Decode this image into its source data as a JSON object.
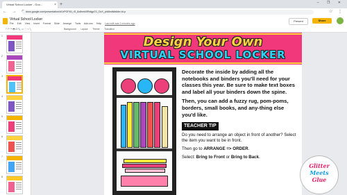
{
  "browser": {
    "tab_title": "Virtual School Locker - Goo...",
    "tab_close": "×",
    "new_tab": "+",
    "url": "docs.google.com/presentation/d/1rPGF45_rD_8z8rmk0lRzfgpO1_DvX_ph8/edit#slide=id.p",
    "nav_icons": "← → ⟳",
    "ext_icons": "☆ ⋮",
    "window_controls": "– ❐ ✕"
  },
  "app": {
    "doc_title": "Virtual School Locker",
    "menu": [
      "File",
      "Edit",
      "View",
      "Insert",
      "Format",
      "Slide",
      "Arrange",
      "Tools",
      "Add-ons",
      "Help"
    ],
    "last_edit": "Last edit was 2 minutes ago",
    "present_label": "Present",
    "share_label": "Share"
  },
  "toolbar": {
    "left": "+ ↶ ↷ 🖶 ⊡ 🔍 ▭ ⬚ ⬭ ╲",
    "right": [
      "Background",
      "Layout",
      "Theme",
      "Transition"
    ]
  },
  "filmstrip": {
    "slides": [
      {
        "num": "1",
        "head": "#f0387a",
        "body": "#7e57c2"
      },
      {
        "num": "2",
        "head": "#ab47bc",
        "body": "#f06292"
      },
      {
        "num": "3",
        "head": "#f0387a",
        "body": "#4fc3f7"
      },
      {
        "num": "4",
        "head": "#ffd23f",
        "body": "#7e57c2"
      },
      {
        "num": "5",
        "head": "#f4b400",
        "body": "#ec407a"
      },
      {
        "num": "6",
        "head": "#ffd23f",
        "body": "#ef5350"
      },
      {
        "num": "7",
        "head": "#f4b400",
        "body": "#42a5f5"
      },
      {
        "num": "8",
        "head": "#ffca28",
        "body": "#f06292"
      }
    ],
    "selected_index": 2
  },
  "slide": {
    "title_line1": "Design Your Own",
    "title_line2": "VIRTUAL SCHOOL LOCKER",
    "para1": "Decorate the inside by adding all the notebooks and binders you'll need for your classes this year. Be sure to make text boxes and label all your binders down the spine.",
    "para2": "Then, you can add a fuzzy rug, pom-poms, borders, small books, and any-thing else you'd like.",
    "tip_label": "TEACHER TIP",
    "tip1": "Do you need to arrange an object in front of another? Select the item you want to be in front.",
    "tip2_pre": "Then go to ",
    "tip2_bold": "ARRANGE => ORDER",
    "tip2_post": ".",
    "tip3_pre": "Select: ",
    "tip3_b1": "Bring to Front",
    "tip3_mid": " or ",
    "tip3_b2": "Bring to Back",
    "tip3_post": "."
  },
  "logo": {
    "line1": "Glitter",
    "line2": "Meets",
    "line3": "Glue"
  },
  "colors": {
    "banner": "#f0387a",
    "title_yellow": "#ffd23f",
    "title_cyan": "#2bd4f4",
    "accent_yellow": "#f4b400"
  }
}
